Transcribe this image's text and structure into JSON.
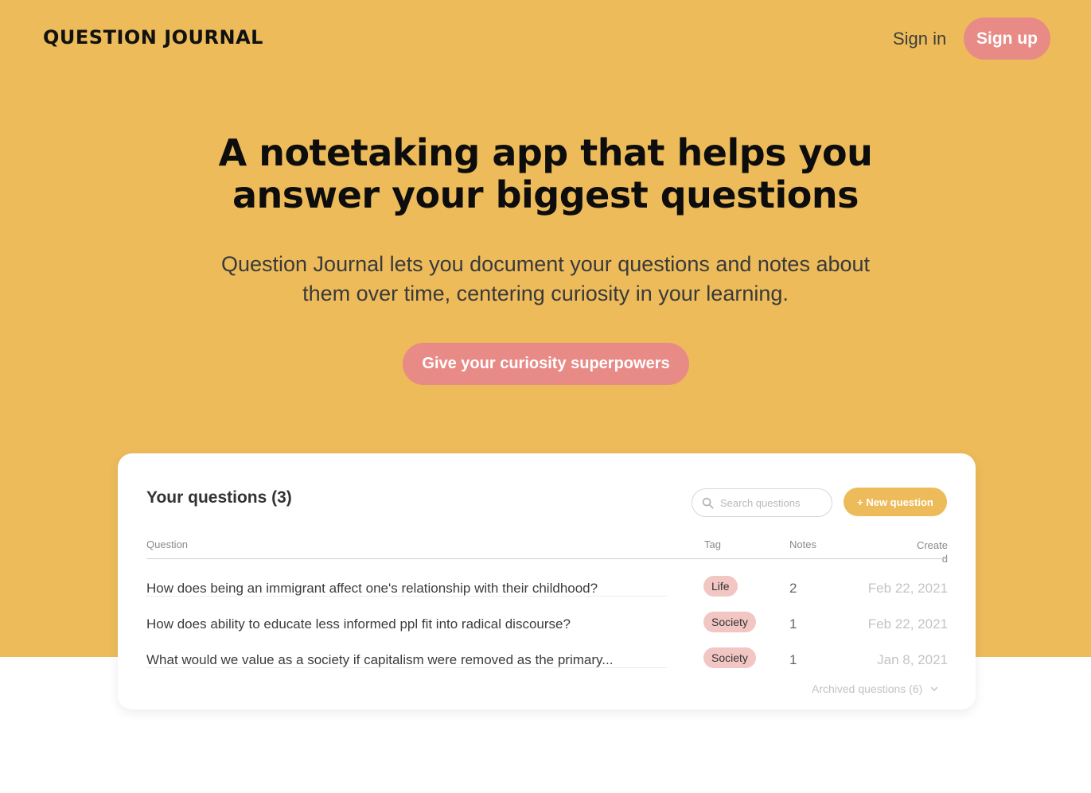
{
  "nav": {
    "logo": "QUESTION JOURNAL",
    "signin": "Sign in",
    "signup": "Sign up"
  },
  "hero": {
    "headline_line1": "A notetaking app that helps you",
    "headline_line2": "answer your biggest questions",
    "subhead_line1": "Question Journal lets you document your questions and notes about",
    "subhead_line2": "them over time, centering curiosity in your learning.",
    "cta": "Give your curiosity superpowers"
  },
  "card": {
    "title": "Your questions (3)",
    "search_placeholder": "Search questions",
    "new_question": "+ New question",
    "columns": {
      "question": "Question",
      "tag": "Tag",
      "notes": "Notes",
      "created_part1": "Create",
      "created_part2": "d"
    },
    "rows": [
      {
        "question": "How does being an immigrant affect one's relationship with their childhood?",
        "tag": "Life",
        "notes": "2",
        "created": "Feb 22, 2021"
      },
      {
        "question": "How does ability to educate less informed ppl fit into radical discourse?",
        "tag": "Society",
        "notes": "1",
        "created": "Feb 22, 2021"
      },
      {
        "question": "What would we value as a society if capitalism were removed as the primary...",
        "tag": "Society",
        "notes": "1",
        "created": "Jan 8, 2021"
      }
    ],
    "archived": "Archived questions (6)"
  },
  "colors": {
    "hero_bg": "#edbb5a",
    "accent_pink": "#e88a86",
    "tag_bg": "#f1c6c3"
  }
}
